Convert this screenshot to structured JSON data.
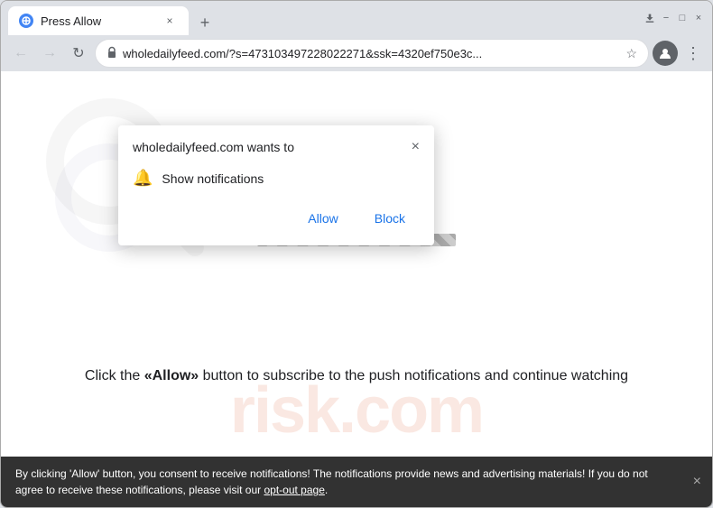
{
  "browser": {
    "title_bar": {
      "tab_title": "Press Allow",
      "close_tab_label": "×",
      "new_tab_label": "+",
      "window_minimize": "−",
      "window_maximize": "□",
      "window_close": "×",
      "download_icon": "⬇"
    },
    "address_bar": {
      "back_icon": "←",
      "forward_icon": "→",
      "reload_icon": "↻",
      "url": "wholedailyfeed.com/?s=473103497228022271&ssk=4320ef750e3c...",
      "lock_icon": "🔒",
      "star_icon": "☆",
      "profile_icon": "👤",
      "menu_icon": "⋮"
    }
  },
  "notification_popup": {
    "title": "wholedailyfeed.com wants to",
    "close_icon": "×",
    "body_text": "Show notifications",
    "bell_icon": "🔔",
    "allow_button": "Allow",
    "block_button": "Block"
  },
  "page": {
    "main_text": "Click the «Allow» button to subscribe to the push notifications and continue watching",
    "watermark_text": "risk.com",
    "progress_bar_visible": true
  },
  "bottom_bar": {
    "text_part1": "By clicking 'Allow' button, you consent to receive notifications! The notifications provide news and advertising materials! If you do not agree to receive these notifications, please visit our ",
    "link_text": "opt-out page",
    "text_part2": ".",
    "close_icon": "×"
  }
}
